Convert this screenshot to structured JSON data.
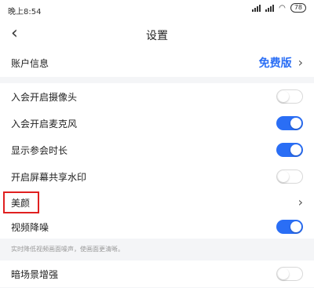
{
  "status": {
    "time": "晚上8:54",
    "battery": "78"
  },
  "header": {
    "title": "设置"
  },
  "account": {
    "label": "账户信息",
    "plan": "免费版"
  },
  "toggles": [
    {
      "label": "入会开启摄像头",
      "on": false
    },
    {
      "label": "入会开启麦克风",
      "on": true
    },
    {
      "label": "显示参会时长",
      "on": true
    },
    {
      "label": "开启屏幕共享水印",
      "on": false
    }
  ],
  "beauty": {
    "label": "美颜"
  },
  "video_noise": {
    "label": "视频降噪",
    "on": true,
    "hint": "实时降低视频画面噪声，使画面更清晰。"
  },
  "lowlight": {
    "label": "暗场景增强",
    "on": false
  },
  "colors": {
    "accent": "#2a6ef5",
    "highlight": "#e02020"
  }
}
